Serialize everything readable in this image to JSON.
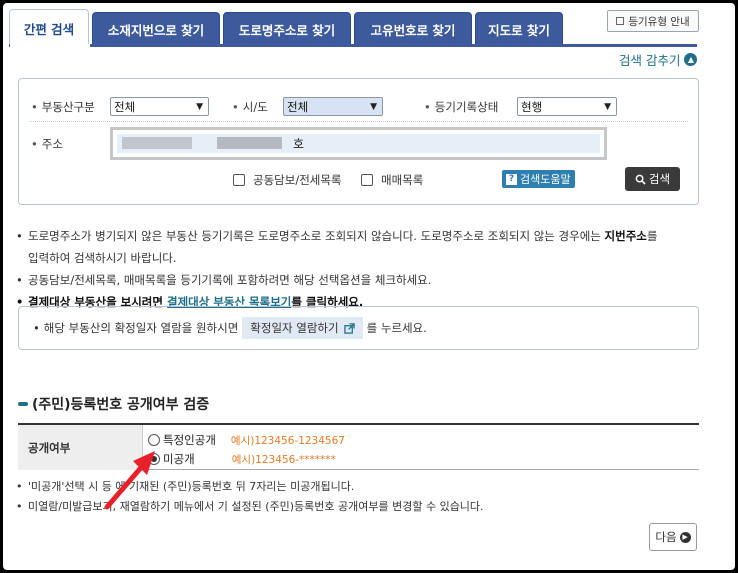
{
  "tabs": [
    {
      "label": "간편 검색",
      "active": true
    },
    {
      "label": "소재지번으로 찾기"
    },
    {
      "label": "도로명주소로 찾기"
    },
    {
      "label": "고유번호로 찾기"
    },
    {
      "label": "지도로 찾기"
    }
  ],
  "guide_button": "등기유형 안내",
  "collapse_label": "검색 감추기",
  "search": {
    "property_type_label": "부동산구분",
    "property_type_value": "전체",
    "city_label": "시/도",
    "city_value": "전체",
    "registry_status_label": "등기기록상태",
    "registry_status_value": "현행",
    "address_label": "주소",
    "address_value_visible": "호",
    "joint_collateral_label": "공동담보/전세목록",
    "sale_list_label": "매매목록",
    "help_label": "검색도움말",
    "search_button": "검색"
  },
  "notes": {
    "n1_a": "도로명주소가 병기되지 않은 부동산 등기기록은 도로명주소로 조회되지 않습니다. 도로명주소로 조회되지 않는 경우에는 ",
    "n1_b": "지번주소",
    "n1_c": "를",
    "n1_d": "입력하여 검색하시기 바랍니다.",
    "n2": "공동담보/전세목록, 매매목록을 등기기록에 포함하려면 해당 선택옵션을 체크하세요.",
    "n3_a": "결제대상 부동산을 보시려면 ",
    "n3_b": "결제대상 부동산 목록보기",
    "n3_c": "를 클릭하세요."
  },
  "info": {
    "text_a": "해당 부동산의 확정일자 열람을 원하시면",
    "button": "확정일자 열람하기",
    "text_b": "를 누르세요."
  },
  "verify": {
    "title": "(주민)등록번호 공개여부 검증",
    "row_label": "공개여부",
    "option1": "특정인공개",
    "option1_example": "예시)123456-1234567",
    "option2": "미공개",
    "option2_example": "예시)123456-*******",
    "selected": "미공개"
  },
  "notes2": {
    "n1": "'미공개'선택 시 등        에 기재된 (주민)등록번호 뒤 7자리는 미공개됩니다.",
    "n2": "미열람/미발급보기, 재열람하기 메뉴에서 기 설정된 (주민)등록번호 공개여부를 변경할 수 있습니다."
  },
  "next_button": "다음",
  "colors": {
    "tab_blue": "#3c5a9c",
    "accent_teal": "#1f6f8a",
    "example_orange": "#e37a2a",
    "arrow_red": "#e8202a"
  }
}
